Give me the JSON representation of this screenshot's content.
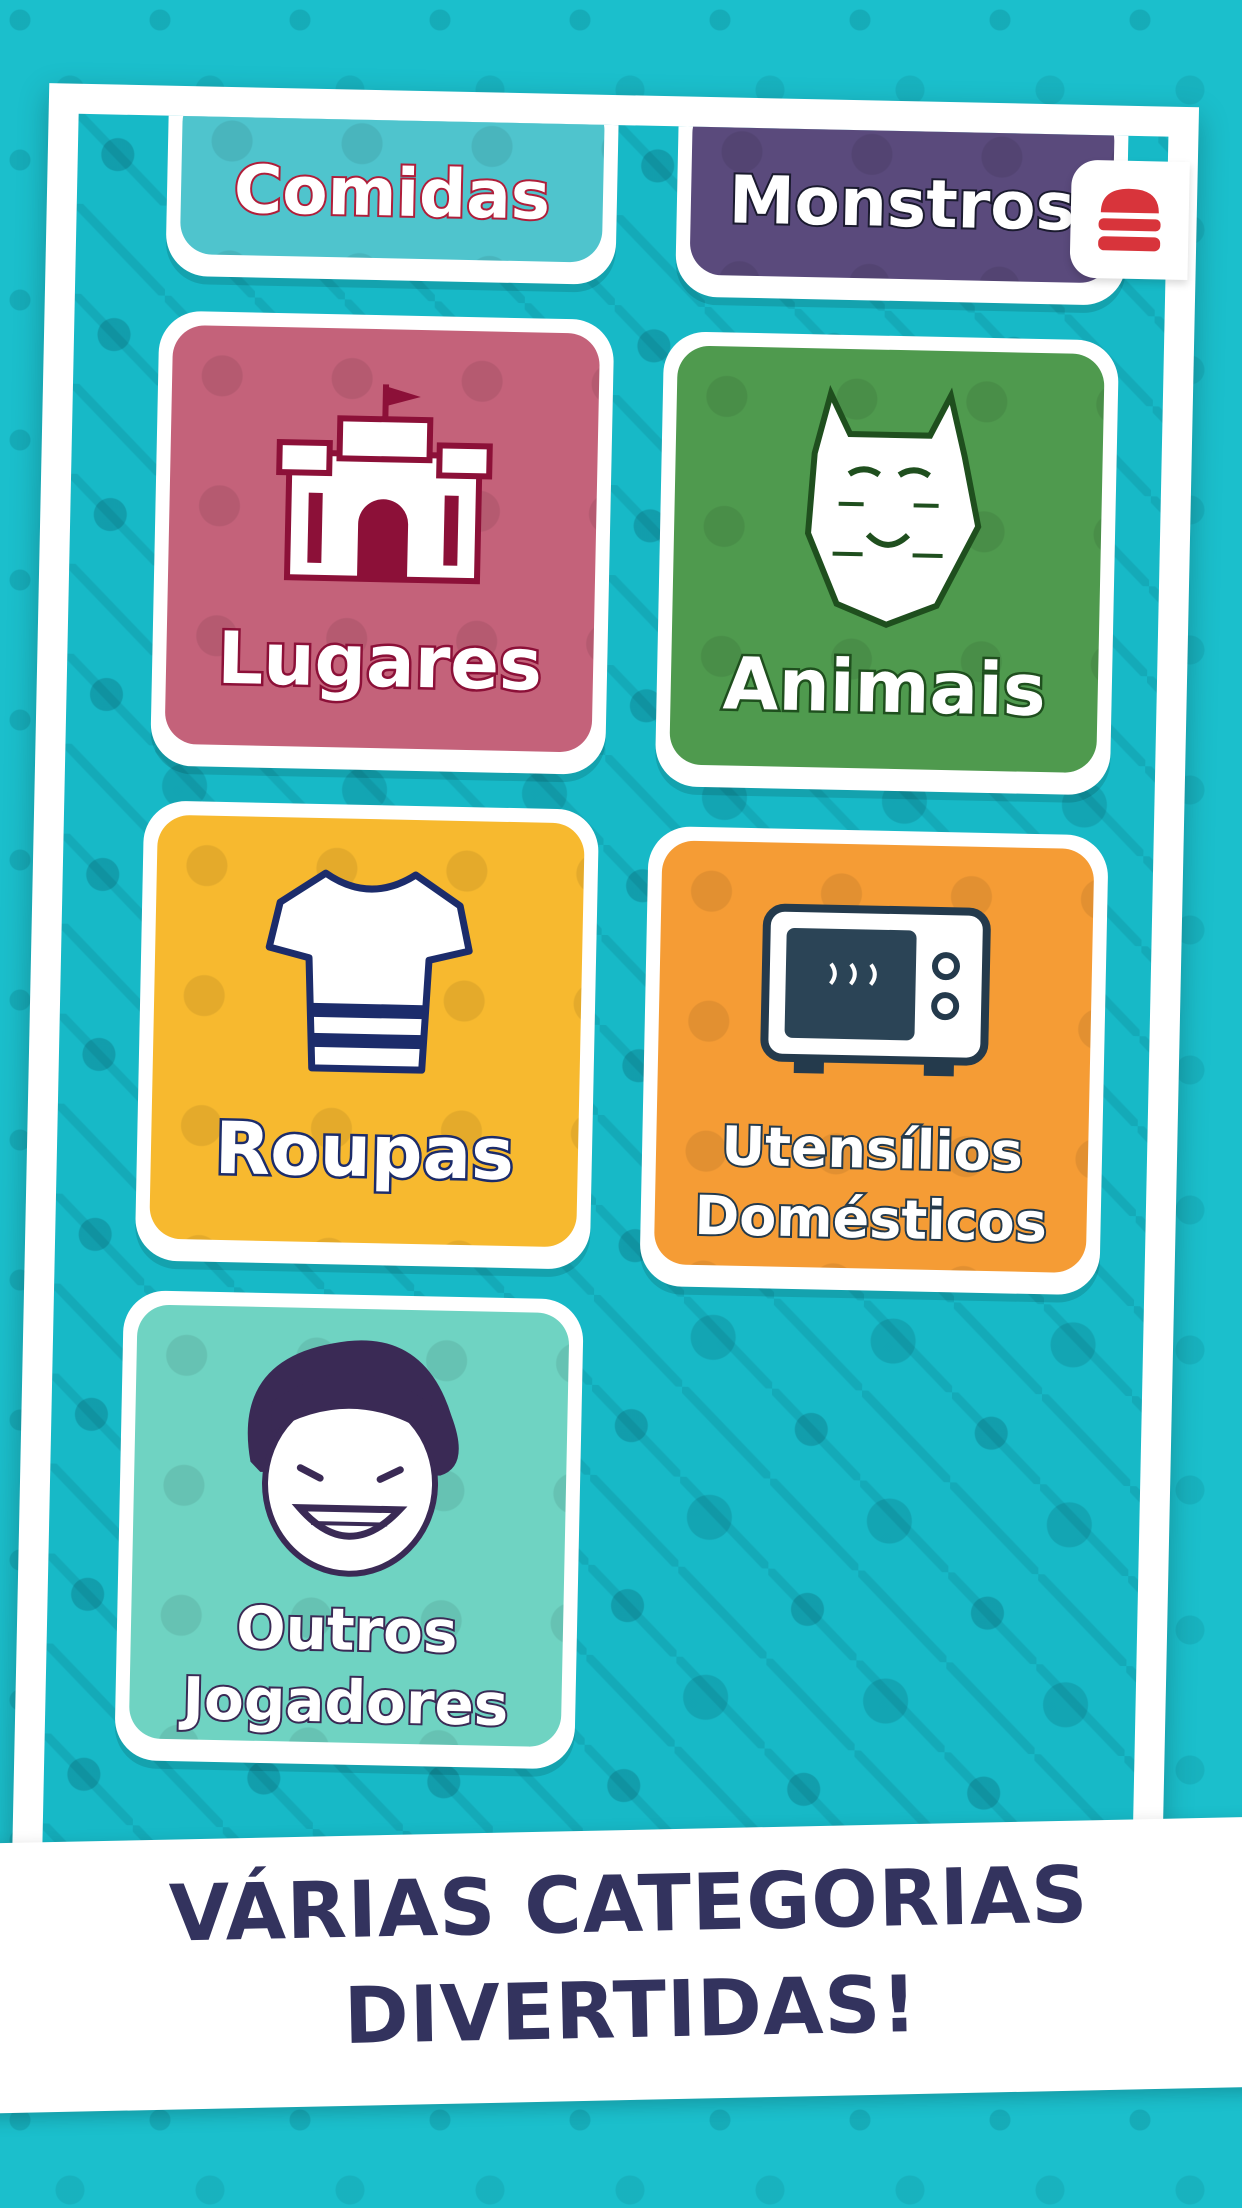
{
  "categories": [
    {
      "label": "Comidas",
      "color": "#4fc4cd",
      "icon": "food-icon"
    },
    {
      "label": "Monstros",
      "color": "#5a4a7c",
      "icon": "monster-icon"
    },
    {
      "label": "Lugares",
      "color": "#c4627a",
      "icon": "castle-icon"
    },
    {
      "label": "Animais",
      "color": "#4f9a4e",
      "icon": "tiger-icon"
    },
    {
      "label": "Roupas",
      "color": "#f7b92f",
      "icon": "tshirt-icon"
    },
    {
      "label_line1": "Utensílios",
      "label_line2": "Domésticos",
      "color": "#f59c35",
      "icon": "microwave-icon"
    },
    {
      "label_line1": "Outros",
      "label_line2": "Jogadores",
      "color": "#6fd3c2",
      "icon": "player-face-icon"
    }
  ],
  "menu": {
    "icon": "burger-menu-icon"
  },
  "banner": {
    "line1": "VÁRIAS CATEGORIAS",
    "line2": "DIVERTIDAS!"
  }
}
